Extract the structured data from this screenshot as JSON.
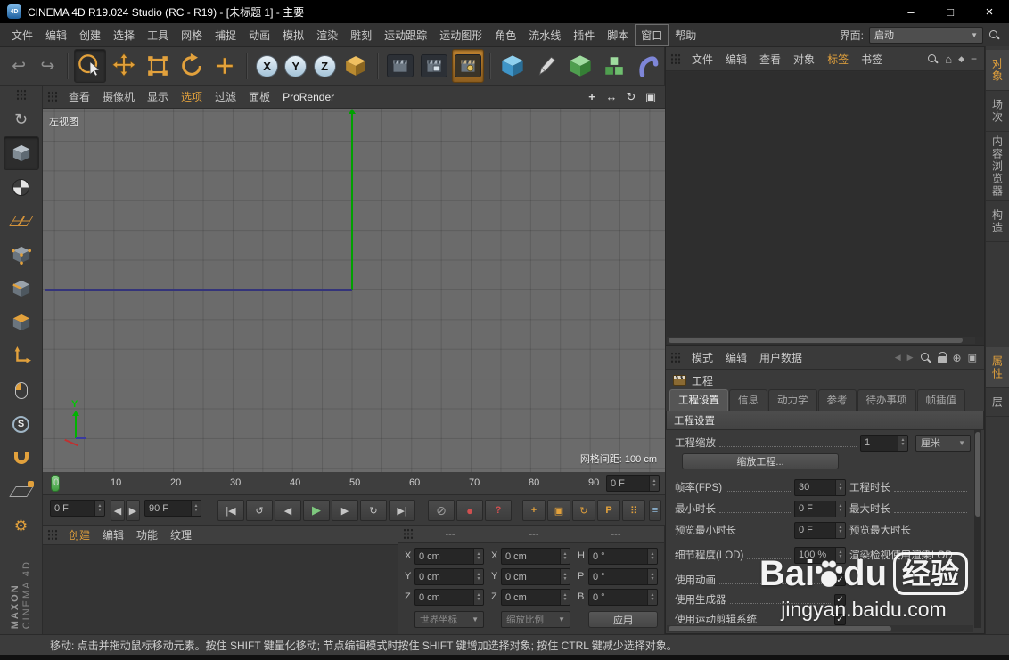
{
  "colors": {
    "accent": "#e2a13c",
    "play_green": "#7ec87e",
    "record_red": "#d05050",
    "axis_green": "#00a000",
    "axis_blue": "#34347a"
  },
  "icons": {
    "spin_up": "▲",
    "spin_down": "▼",
    "dropdown_arrow": "▼",
    "home": "⌂",
    "diamond": "◆",
    "minus": "−",
    "back": "◀",
    "forward": "▶",
    "target": "⊕",
    "grid": "▣",
    "gear": "⚙",
    "undo": "↩",
    "redo": "↪",
    "pan": "+",
    "zoom": "↔",
    "rotate_view": "↻",
    "toggle_view": "▣",
    "convert": "↻"
  },
  "title_bar": {
    "app_logo_text": "4D",
    "title": "CINEMA 4D R19.024 Studio (RC - R19) - [未标题 1] - 主要",
    "minimize_glyph": "–",
    "maximize_glyph": "□",
    "close_glyph": "×"
  },
  "menu_bar": {
    "items": [
      "文件",
      "编辑",
      "创建",
      "选择",
      "工具",
      "网格",
      "捕捉",
      "动画",
      "模拟",
      "渲染",
      "雕刻",
      "运动跟踪",
      "运动图形",
      "角色",
      "流水线",
      "插件",
      "脚本",
      "窗口",
      "帮助"
    ],
    "interface_label": "界面:",
    "interface_value": "启动"
  },
  "toolbar": {
    "axis_x": "X",
    "axis_y": "Y",
    "axis_z": "Z"
  },
  "viewport": {
    "menu_items": [
      "查看",
      "摄像机",
      "显示",
      "选项",
      "过滤",
      "面板",
      "ProRender"
    ],
    "view_label": "左视图",
    "grid_spacing": "网格间距: 100 cm",
    "axis_label_y": "Y"
  },
  "timeline": {
    "ticks": [
      "0",
      "10",
      "20",
      "30",
      "40",
      "50",
      "60",
      "70",
      "80",
      "90"
    ],
    "frame_field": "0 F"
  },
  "transport": {
    "start_field": "0 F",
    "end_field": "90 F",
    "step_back_glyph": "◀",
    "step_forward_glyph": "▶",
    "buttons": [
      {
        "name": "goto-start",
        "glyph": "|◀"
      },
      {
        "name": "play-backward",
        "glyph": "↺"
      },
      {
        "name": "previous-frame",
        "glyph": "◀"
      },
      {
        "name": "play-forward",
        "glyph": "▶"
      },
      {
        "name": "next-frame",
        "glyph": "▶"
      },
      {
        "name": "play-loop",
        "glyph": "↻"
      },
      {
        "name": "goto-end",
        "glyph": "▶|"
      }
    ],
    "record_buttons": [
      {
        "name": "record-keyframe",
        "glyph": "⊘"
      },
      {
        "name": "record-objects",
        "glyph": "●"
      },
      {
        "name": "autokeying",
        "glyph": "?"
      }
    ],
    "key_toggles": [
      {
        "name": "key-position",
        "glyph": "+"
      },
      {
        "name": "key-scale",
        "glyph": "▣"
      },
      {
        "name": "key-rotation",
        "glyph": "↻"
      },
      {
        "name": "key-parameter",
        "glyph": "P"
      },
      {
        "name": "key-pla",
        "glyph": "⠿"
      }
    ],
    "layout_glyph": "≡"
  },
  "material_manager": {
    "menu_items": [
      "创建",
      "编辑",
      "功能",
      "纹理"
    ]
  },
  "coordinates": {
    "col_headers": [
      "---",
      "---",
      "---"
    ],
    "labels": {
      "r1c1": "X",
      "r2c1": "Y",
      "r3c1": "Z",
      "r1c2": "X",
      "r2c2": "Y",
      "r3c2": "Z",
      "r1c3": "H",
      "r2c3": "P",
      "r3c3": "B"
    },
    "values": {
      "r1c1": "0 cm",
      "r2c1": "0 cm",
      "r3c1": "0 cm",
      "r1c2": "0 cm",
      "r2c2": "0 cm",
      "r3c2": "0 cm",
      "r1c3": "0 °",
      "r2c3": "0 °",
      "r3c3": "0 °"
    },
    "system_dropdown": "世界坐标",
    "scale_dropdown": "缩放比例",
    "apply_button": "应用"
  },
  "object_manager": {
    "menu_items": [
      "文件",
      "编辑",
      "查看",
      "对象",
      "标签",
      "书签"
    ]
  },
  "attribute_manager": {
    "menu_items": [
      "模式",
      "编辑",
      "用户数据"
    ],
    "panel_title": "工程",
    "tabs": [
      "工程设置",
      "信息",
      "动力学",
      "参考",
      "待办事项",
      "帧插值"
    ],
    "section_title": "工程设置",
    "project_scale_label": "工程缩放",
    "project_scale_value": "1",
    "project_scale_unit": "厘米",
    "scale_project_button": "缩放工程...",
    "fps_label": "帧率(FPS)",
    "fps_value": "30",
    "duration_label": "工程时长",
    "min_time_label": "最小时长",
    "min_time_value": "0 F",
    "max_time_label": "最大时长",
    "preview_min_label": "预览最小时长",
    "preview_min_value": "0 F",
    "preview_max_label": "预览最大时长",
    "lod_label": "细节程度(LOD)",
    "lod_value": "100 %",
    "render_lod_label": "渲染检视使用渲染LOD",
    "use_animation_label": "使用动画",
    "use_generators_label": "使用生成器",
    "use_motion_system_label": "使用运动剪辑系统",
    "check_glyph": "✓"
  },
  "side_tabs": {
    "top": [
      "对象",
      "场次",
      "内容浏览器",
      "构造"
    ],
    "bottom": [
      "属性",
      "层"
    ]
  },
  "status_bar": {
    "text": "移动: 点击并拖动鼠标移动元素。按住 SHIFT 键量化移动; 节点编辑模式时按住 SHIFT 键增加选择对象; 按住 CTRL 键减少选择对象。"
  },
  "watermark": {
    "brand_left": "Bai",
    "brand_right": "du",
    "suffix": "经验",
    "url": "jingyan.baidu.com"
  },
  "branding": {
    "maxon": "MAXON",
    "cinema4d": "CINEMA 4D"
  }
}
